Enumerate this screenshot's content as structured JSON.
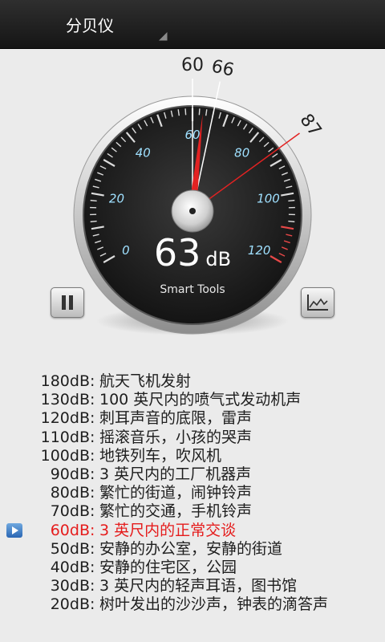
{
  "app": {
    "title": "分贝仪"
  },
  "gauge": {
    "current_value": 63,
    "unit": "dB",
    "brand": "Smart Tools",
    "scale_min": 0,
    "scale_max": 120,
    "scale_labels": [
      "0",
      "20",
      "40",
      "60",
      "80",
      "100",
      "120"
    ],
    "markers": [
      {
        "value": 60,
        "label": "60",
        "color": "#ffffff"
      },
      {
        "value": 66,
        "label": "66",
        "color": "#ffffff"
      },
      {
        "value": 87,
        "label": "87",
        "color": "#e32222"
      }
    ],
    "needle_color": "#e32222",
    "danger_color": "#e84848"
  },
  "controls": {
    "pause_icon": "pause-icon",
    "graph_icon": "line-chart-icon"
  },
  "reference": {
    "active_index": 8,
    "active_color": "#e51c1c",
    "rows": [
      {
        "db": "180dB",
        "desc": "航天飞机发射"
      },
      {
        "db": "130dB",
        "desc": "100 英尺内的喷气式发动机声"
      },
      {
        "db": "120dB",
        "desc": "刺耳声音的底限，雷声"
      },
      {
        "db": "110dB",
        "desc": "摇滚音乐，小孩的哭声"
      },
      {
        "db": "100dB",
        "desc": "地铁列车，吹风机"
      },
      {
        "db": "90dB",
        "desc": "3 英尺内的工厂机器声"
      },
      {
        "db": "80dB",
        "desc": "繁忙的街道，闹钟铃声"
      },
      {
        "db": "70dB",
        "desc": "繁忙的交通，手机铃声"
      },
      {
        "db": "60dB",
        "desc": "3 英尺内的正常交谈"
      },
      {
        "db": "50dB",
        "desc": "安静的办公室，安静的街道"
      },
      {
        "db": "40dB",
        "desc": "安静的住宅区，公园"
      },
      {
        "db": "30dB",
        "desc": "3 英尺内的轻声耳语，图书馆"
      },
      {
        "db": "20dB",
        "desc": "树叶发出的沙沙声，钟表的滴答声"
      }
    ]
  }
}
